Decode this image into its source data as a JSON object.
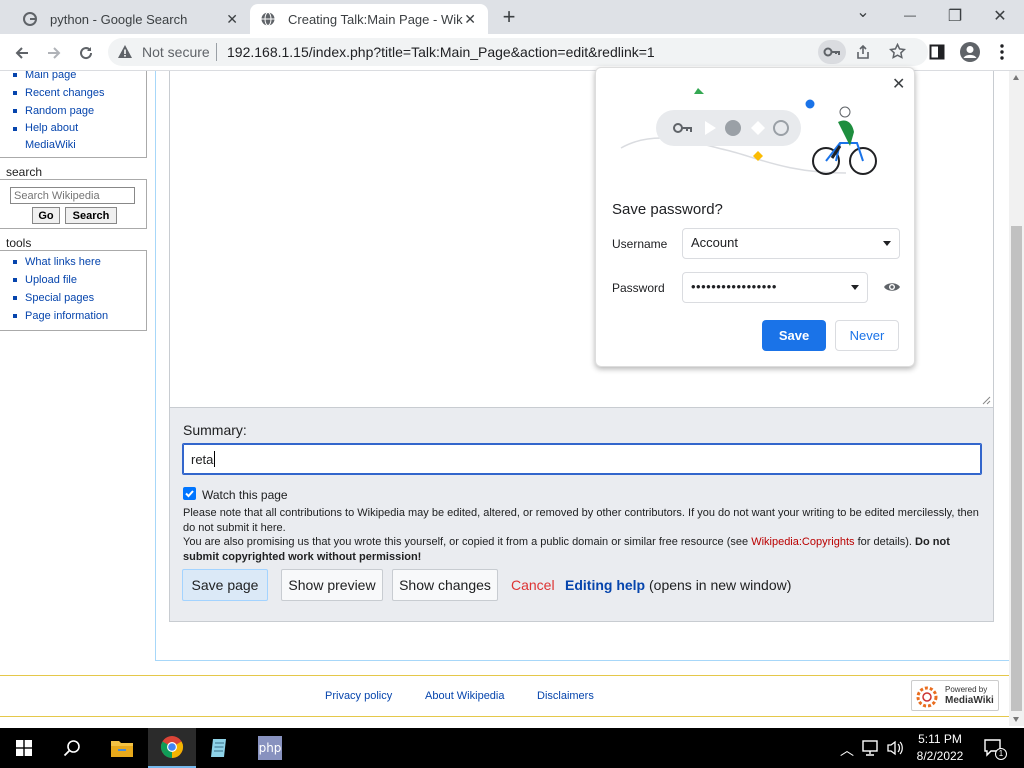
{
  "browser": {
    "tabs": [
      {
        "title": "python - Google Search",
        "active": false
      },
      {
        "title": "Creating Talk:Main Page - Wikipe",
        "active": true
      }
    ],
    "new_tab": "+",
    "window_controls": {
      "minimize": "—",
      "restore": "❐",
      "close": "✕",
      "dropdown": "⌄"
    },
    "address": {
      "security": "Not secure",
      "url": "192.168.1.15/index.php?title=Talk:Main_Page&action=edit&redlink=1"
    }
  },
  "sidebar": {
    "nav_items": [
      "Main page",
      "Recent changes",
      "Random page",
      "Help about MediaWiki"
    ],
    "search": {
      "heading": "search",
      "placeholder": "Search Wikipedia",
      "go_label": "Go",
      "search_label": "Search"
    },
    "tools": {
      "heading": "tools",
      "items": [
        "What links here",
        "Upload file",
        "Special pages",
        "Page information"
      ]
    }
  },
  "editor": {
    "summary_label": "Summary:",
    "summary_value": "reta",
    "watch_label": "Watch this page",
    "watch_checked": true,
    "notice_line1": "Please note that all contributions to Wikipedia may be edited, altered, or removed by other contributors. If you do not want your writing to be edited mercilessly, then do not submit it here.",
    "notice_line2_pre": "You are also promising us that you wrote this yourself, or copied it from a public domain or similar free resource (see ",
    "notice_link": "Wikipedia:Copyrights",
    "notice_line2_mid": " for details). ",
    "notice_bold": "Do not submit copyrighted work without permission!",
    "save_label": "Save page",
    "preview_label": "Show preview",
    "changes_label": "Show changes",
    "cancel_label": "Cancel",
    "help_label": "Editing help",
    "help_suffix": "(opens in new window)"
  },
  "footer": {
    "links": [
      "Privacy policy",
      "About Wikipedia",
      "Disclaimers"
    ],
    "powered_line1": "Powered by",
    "powered_line2": "MediaWiki"
  },
  "password_popup": {
    "title": "Save password?",
    "username_label": "Username",
    "username_value": "Account",
    "password_label": "Password",
    "password_value": "•••••••••••••••••",
    "save_label": "Save",
    "never_label": "Never",
    "close": "✕"
  },
  "taskbar": {
    "time": "5:11 PM",
    "date": "8/2/2022",
    "php_label": "php",
    "notification_count": "1"
  },
  "colors": {
    "link": "#0645ad",
    "chrome_blue": "#1a73e8",
    "red_link": "#ba0000",
    "mw_blue_button": "#eaf3ff"
  }
}
